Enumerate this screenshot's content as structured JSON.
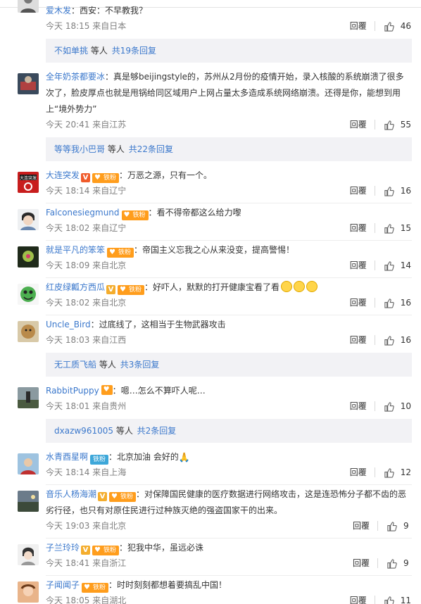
{
  "common": {
    "reply_label": "回覆",
    "more_people": "等人",
    "fan_label": "铁粉",
    "vip_label": "V"
  },
  "comments": [
    {
      "user": "爱木发",
      "text": "西安：不早教我？",
      "time": "今天 18:15 来自日本",
      "likes": "46",
      "sub": {
        "who": "不如单挑",
        "more": "共19条回复"
      }
    },
    {
      "user": "全年奶茶都要冰",
      "text": "真是够beijingstyle的，苏州从2月份的疫情开始，录入核酸的系统崩溃了很多次了，脸皮厚点也就是甩锅给同区域用户上网占量太多造成系统网络崩溃。还得是你，能想到用上“境外势力”",
      "time": "今天 20:41 来自江苏",
      "likes": "55",
      "sub": {
        "who": "等等我小巴哥",
        "more": "共22条回复"
      }
    },
    {
      "user": "大连突发",
      "text": "万恶之源，只有一个。",
      "time": "今天 18:14 来自辽宁",
      "likes": "16"
    },
    {
      "user": "Falconesiegmund",
      "text": "看不得帝都这么给力嚟",
      "time": "今天 18:02 来自辽宁",
      "likes": "15"
    },
    {
      "user": "就是平凡的笨笨",
      "text": "帝国主义忘我之心从来没变，提高警惕！",
      "time": "今天 18:09 来自北京",
      "likes": "14"
    },
    {
      "user": "红皮绿瓤方西瓜",
      "text": "好吓人，默默的打开健康宝看了看",
      "time": "今天 18:02 来自北京",
      "likes": "16"
    },
    {
      "user": "Uncle_Bird",
      "text": "过底线了，这相当于生物武器攻击",
      "time": "今天 18:03 来自江西",
      "likes": "16",
      "sub": {
        "who": "无工质飞船",
        "more": "共3条回复"
      }
    },
    {
      "user": "RabbitPuppy",
      "text": "嗯…怎么不算吓人呢…",
      "time": "今天 18:01 来自贵州",
      "likes": "10",
      "sub": {
        "who": "dxazw961005",
        "more": "共2条回复"
      }
    },
    {
      "user": "水青酉星啊",
      "text": "北京加油 会好的",
      "time": "今天 18:14 来自上海",
      "likes": "12"
    },
    {
      "user": "音乐人杨海潮",
      "text": "对保障国民健康的医疗数据进行网络攻击，这是连恐怖分子都不齿的恶劣行径，也只有对原住民进行过种族灭绝的强盗国家干的出来。",
      "time": "今天 19:03 来自北京",
      "likes": "9"
    },
    {
      "user": "子兰玲玲",
      "text": "犯我中华，虽远必诛",
      "time": "今天 18:41 来自浙江",
      "likes": "9"
    },
    {
      "user": "子闻闻子",
      "text": "时时刻刻都想着要搞乱中国！",
      "time": "今天 18:05 来自湖北",
      "likes": "11"
    }
  ]
}
